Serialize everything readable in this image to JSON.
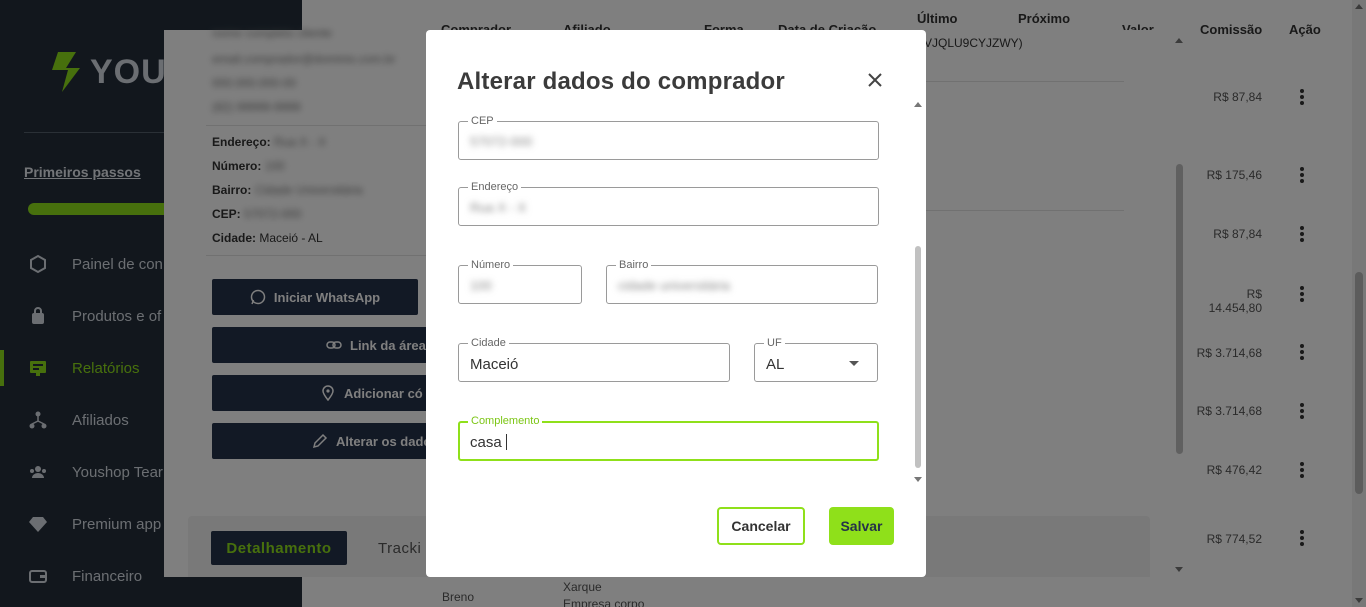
{
  "sidebar": {
    "brand": "YOU",
    "first_steps": "Primeiros passos",
    "items": [
      {
        "label": "Painel de con",
        "icon": "dashboard-icon"
      },
      {
        "label": "Produtos e of",
        "icon": "bag-icon"
      },
      {
        "label": "Relatórios",
        "icon": "report-icon"
      },
      {
        "label": "Afiliados",
        "icon": "network-icon"
      },
      {
        "label": "Youshop Tear",
        "icon": "team-icon"
      },
      {
        "label": "Premium app",
        "icon": "diamond-icon"
      },
      {
        "label": "Financeiro",
        "icon": "wallet-icon"
      }
    ]
  },
  "table": {
    "headers": {
      "comprador": "Comprador",
      "afiliado": "Afiliado",
      "forma": "Forma",
      "data_criacao": "Data de Criação",
      "ultimo": "Último",
      "proximo": "Próximo",
      "valor": "Valor",
      "comissao": "Comissão",
      "acao": "Ação"
    },
    "commissions": [
      "R$ 87,84",
      "R$ 175,46",
      "R$ 87,84",
      "R$ 14.454,80",
      "R$ 3.714,68",
      "R$ 3.714,68",
      "R$ 476,42",
      "R$ 774,52"
    ],
    "bottom_texts": [
      "Breno",
      "Xarque",
      "Empresa corpo"
    ]
  },
  "panel": {
    "blur_lines": [
      "nome completo cliente",
      "email.comprador@dominio.com.br",
      "000.000.000-00",
      "(82) 99999-9999"
    ],
    "address_label": "Endereço:",
    "address_value": "Rua X - X",
    "number_label": "Número:",
    "number_value": "100",
    "bairro_label": "Bairro:",
    "bairro_value": "Cidade Universitária",
    "cep_label": "CEP:",
    "cep_value": "57072-000",
    "city_label": "Cidade:",
    "city_value": "Maceió - AL",
    "btn_whatsapp": "Iniciar WhatsApp",
    "btn_link": "Link da área",
    "btn_add": "Adicionar có",
    "btn_edit": "Alterar os dado",
    "tab_detail": "Detalhamento",
    "tab_tracking": "Tracki",
    "code_text": "VJQLU9CYJZWY)"
  },
  "modal": {
    "title": "Alterar dados do comprador",
    "fields": {
      "cep": {
        "label": "CEP",
        "value": "57072-000"
      },
      "endereco": {
        "label": "Endereço",
        "value": "Rua X - X"
      },
      "numero": {
        "label": "Número",
        "value": "100"
      },
      "bairro": {
        "label": "Bairro",
        "value": "cidade universitária"
      },
      "cidade": {
        "label": "Cidade",
        "value": "Maceió"
      },
      "uf": {
        "label": "UF",
        "value": "AL"
      },
      "complemento": {
        "label": "Complemento",
        "value": "casa"
      }
    },
    "cancel_label": "Cancelar",
    "save_label": "Salvar"
  },
  "colors": {
    "accent": "#8fe01a",
    "navy": "#25324a",
    "sidebar_bg": "#242f3b"
  }
}
